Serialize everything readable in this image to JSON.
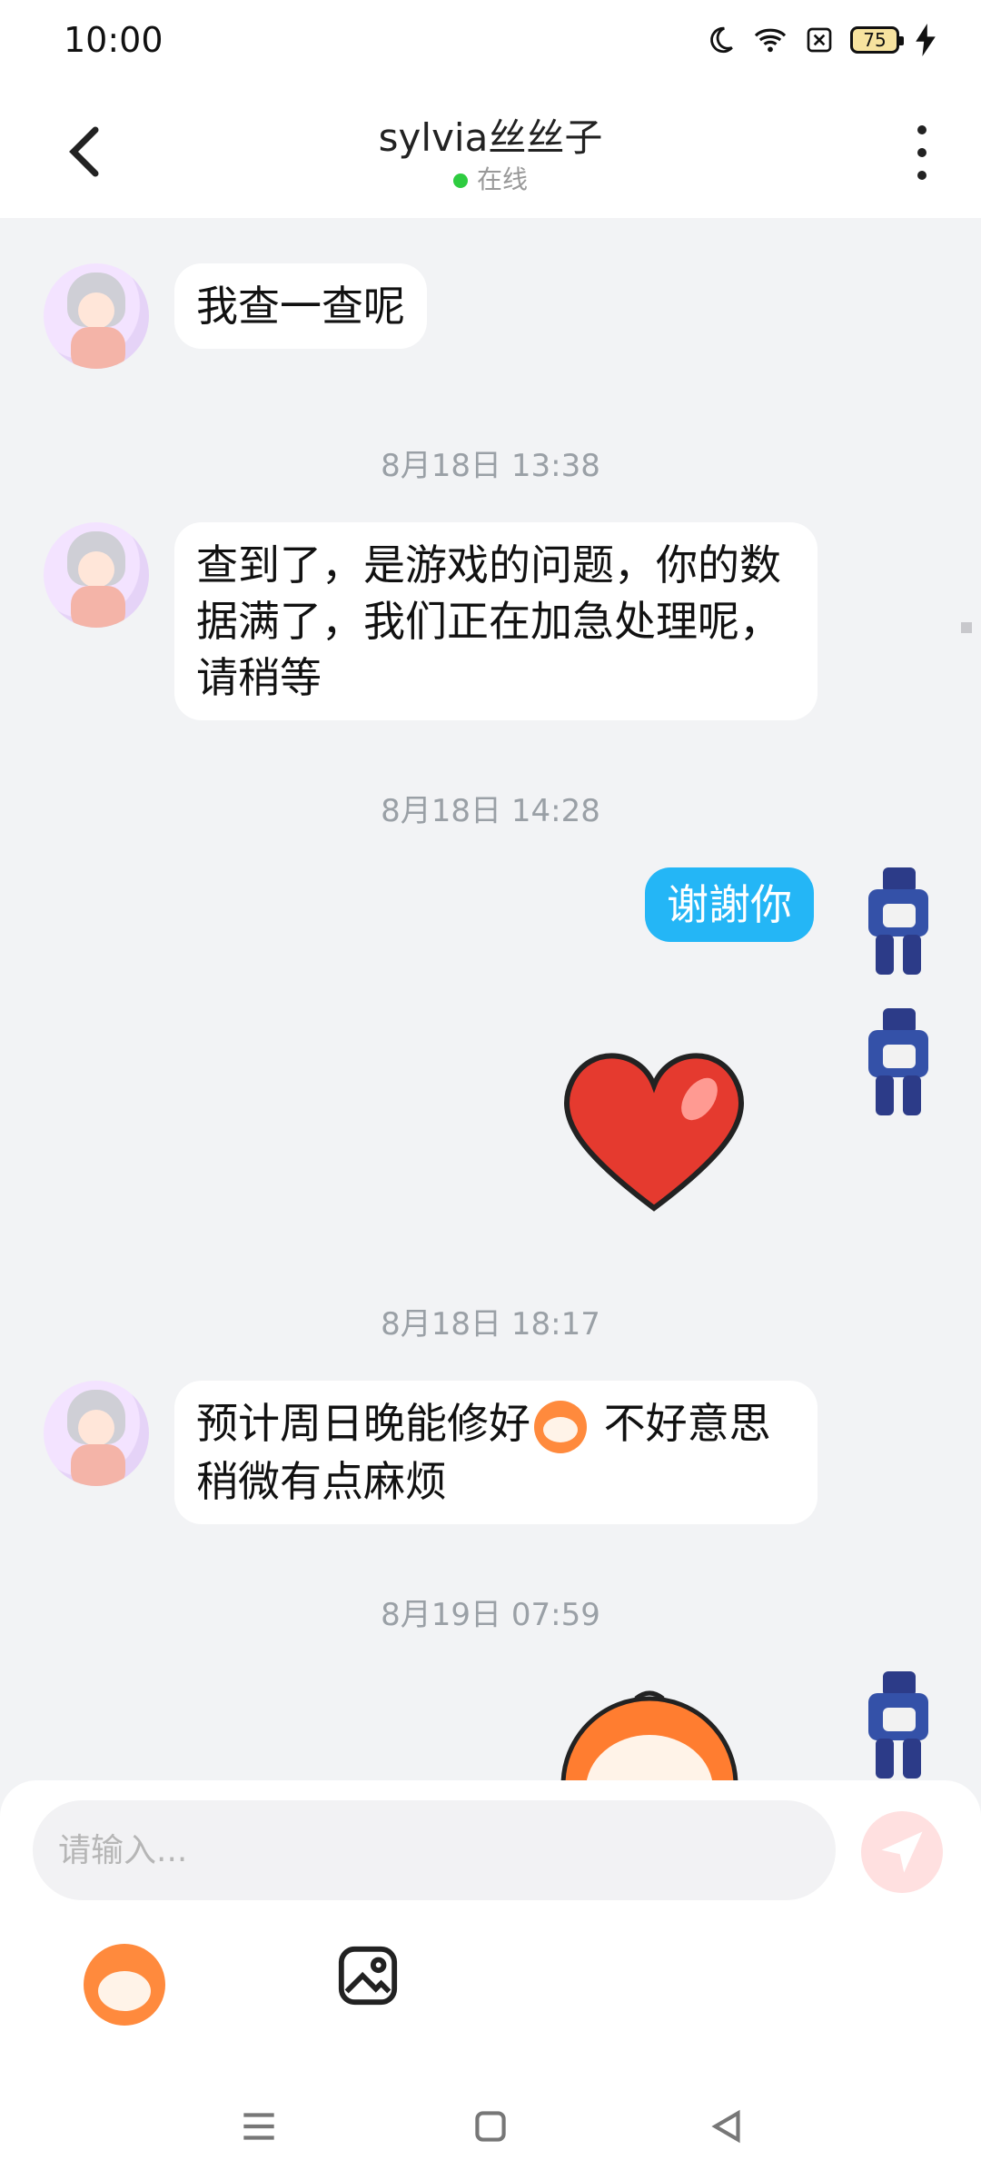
{
  "status": {
    "time": "10:00",
    "battery": "75"
  },
  "header": {
    "title": "sylvia丝丝子",
    "status": "在线"
  },
  "messages": {
    "m1": "我查一查呢",
    "t1": "8月18日 13:38",
    "m2": "查到了，是游戏的问题，你的数据满了，我们正在加急处理呢，请稍等",
    "t2": "8月18日 14:28",
    "m3": "谢謝你",
    "t3": "8月18日 18:17",
    "m4_part1": "预计周日晚能修好",
    "m4_part2": " 不好意思稍微有点麻烦",
    "t4": "8月19日 07:59"
  },
  "composer": {
    "placeholder": "请输入..."
  },
  "colors": {
    "accent": "#24b6f6",
    "background": "#f2f3f5"
  }
}
